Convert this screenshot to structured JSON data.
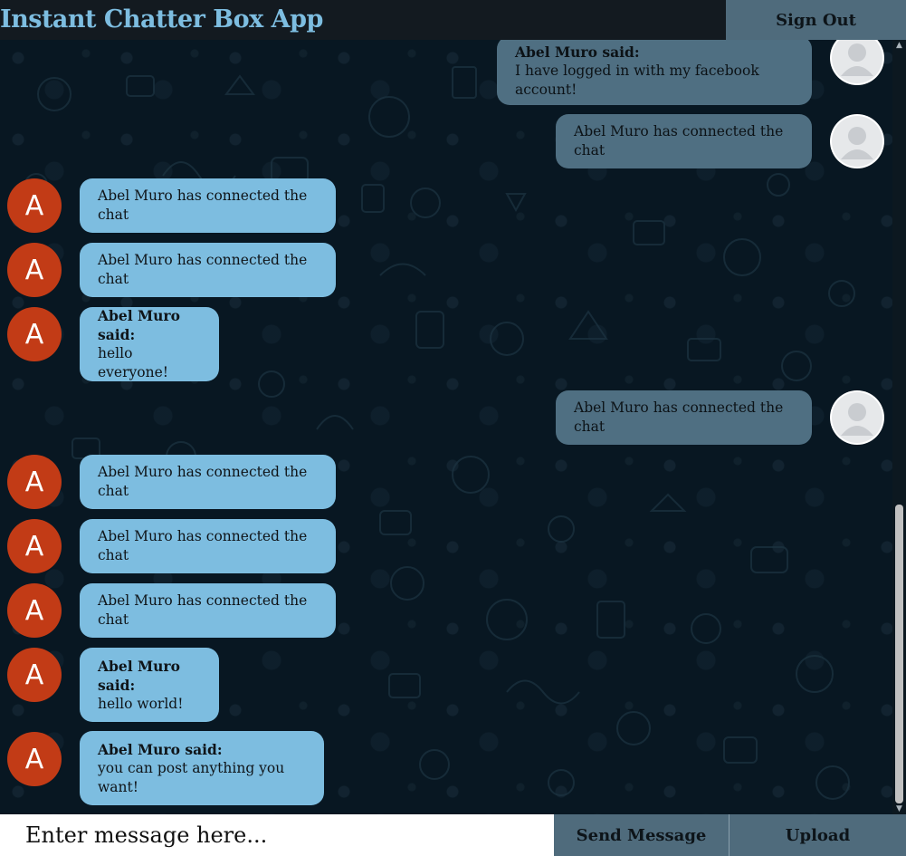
{
  "header": {
    "title": "Instant Chatter Box App",
    "signout_label": "Sign Out"
  },
  "messages": [
    {
      "side": "right",
      "sender": "Abel Muro said:",
      "text": "I have logged in with my facebook account!",
      "avatar": "default-user-icon"
    },
    {
      "side": "right",
      "sender": "",
      "text": "Abel Muro has connected the chat",
      "avatar": "default-user-icon"
    },
    {
      "side": "left",
      "sender": "",
      "text": "Abel Muro has connected the chat",
      "avatar": "A"
    },
    {
      "side": "left",
      "sender": "",
      "text": "Abel Muro has connected the chat",
      "avatar": "A"
    },
    {
      "side": "left",
      "sender": "Abel Muro said:",
      "text": "hello everyone!",
      "avatar": "A"
    },
    {
      "side": "right",
      "sender": "",
      "text": "Abel Muro has connected the chat",
      "avatar": "default-user-icon"
    },
    {
      "side": "left",
      "sender": "",
      "text": "Abel Muro has connected the chat",
      "avatar": "A"
    },
    {
      "side": "left",
      "sender": "",
      "text": "Abel Muro has connected the chat",
      "avatar": "A"
    },
    {
      "side": "left",
      "sender": "",
      "text": "Abel Muro has connected the chat",
      "avatar": "A"
    },
    {
      "side": "left",
      "sender": "Abel Muro said:",
      "text": "hello world!",
      "avatar": "A"
    },
    {
      "side": "left",
      "sender": "Abel Muro said:",
      "text": "you can post anything you want!",
      "avatar": "A"
    }
  ],
  "footer": {
    "input_placeholder": "Enter message here...",
    "send_label": "Send Message",
    "upload_label": "Upload"
  },
  "colors": {
    "accent": "#7dbde0",
    "button": "#4f6b7c",
    "avatar_letter_bg": "#c23b16",
    "background": "#081722"
  }
}
